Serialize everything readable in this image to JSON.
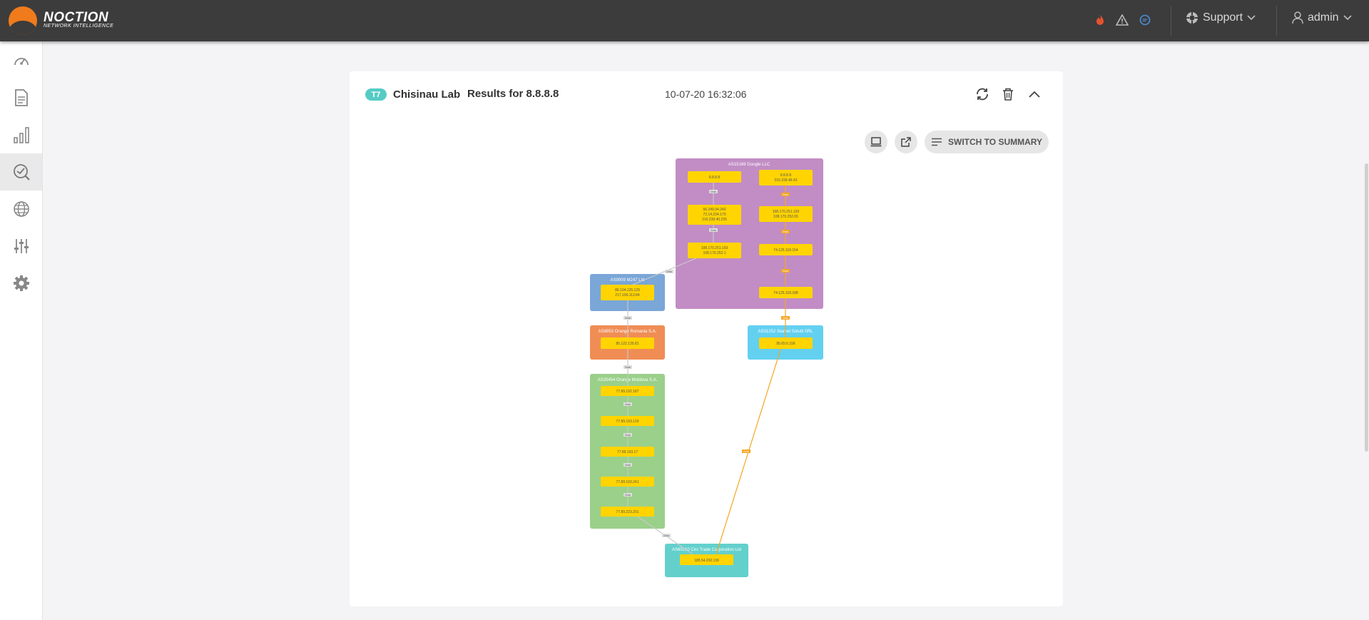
{
  "brand": {
    "name": "NOCTION",
    "subtitle": "NETWORK INTELLIGENCE"
  },
  "header": {
    "support_label": "Support",
    "user_label": "admin",
    "icons": [
      "fire-icon",
      "warning-icon",
      "chat-icon"
    ]
  },
  "sidebar": {
    "items": [
      {
        "name": "dashboard-icon"
      },
      {
        "name": "reports-icon"
      },
      {
        "name": "statistics-icon"
      },
      {
        "name": "diagnostics-icon",
        "active": true
      },
      {
        "name": "globe-icon"
      },
      {
        "name": "sliders-icon"
      },
      {
        "name": "settings-icon"
      }
    ]
  },
  "result": {
    "badge": "T7",
    "name": "Chisinau Lab",
    "title": "Results for 8.8.8.8",
    "timestamp": "10-07-20 16:32:06",
    "switch_label": "SWITCH TO SUMMARY"
  },
  "graph": {
    "groups": [
      {
        "label": "AS15169 Google LLC",
        "color": "#c18dc4"
      },
      {
        "label": "AS9009 M247 Ltd",
        "color": "#7aa6d8"
      },
      {
        "label": "AS8953 Orange Romania S.A.",
        "color": "#f08d55"
      },
      {
        "label": "AS31252 Starnet Solutii SRL",
        "color": "#63d0f0"
      },
      {
        "label": "AS25454 Orange Moldova S.A.",
        "color": "#9ad08a"
      },
      {
        "label": "AS60210 Cirx Trade Corporation Ltd",
        "color": "#63d0cc"
      }
    ],
    "nodes": [
      {
        "lines": [
          "8.8.8.8"
        ]
      },
      {
        "lines": [
          "8.8.8.8",
          "216.239.46.43"
        ]
      },
      {
        "lines": [
          "66.249.94.240",
          "72.14.234.170",
          "216.239.40.235"
        ]
      },
      {
        "lines": [
          "108.170.251.193",
          "108.170.252.65"
        ]
      },
      {
        "lines": [
          "108.170.251.193",
          "108.170.252.1"
        ]
      },
      {
        "lines": [
          "74.125.118.154"
        ]
      },
      {
        "lines": [
          "74.125.118.188"
        ]
      },
      {
        "lines": [
          "86.104.125.129",
          "217.156.113.84"
        ]
      },
      {
        "lines": [
          "95.65.6.156"
        ]
      },
      {
        "lines": [
          "85.122.135.81"
        ]
      },
      {
        "lines": [
          "77.89.192.187"
        ]
      },
      {
        "lines": [
          "77.89.193.129"
        ]
      },
      {
        "lines": [
          "77.89.193.17"
        ]
      },
      {
        "lines": [
          "77.89.193.241"
        ]
      },
      {
        "lines": [
          "77.89.223.201"
        ]
      },
      {
        "lines": [
          "185.54.202.136"
        ]
      }
    ],
    "edge_labels": [
      "0ms",
      "0ms",
      "0ms",
      "0ms",
      "0ms",
      "0ms",
      "0ms",
      "0ms",
      "0ms",
      "0ms",
      "0ms",
      "0ms",
      "0ms",
      "0ms",
      "0ms",
      "0ms"
    ]
  }
}
